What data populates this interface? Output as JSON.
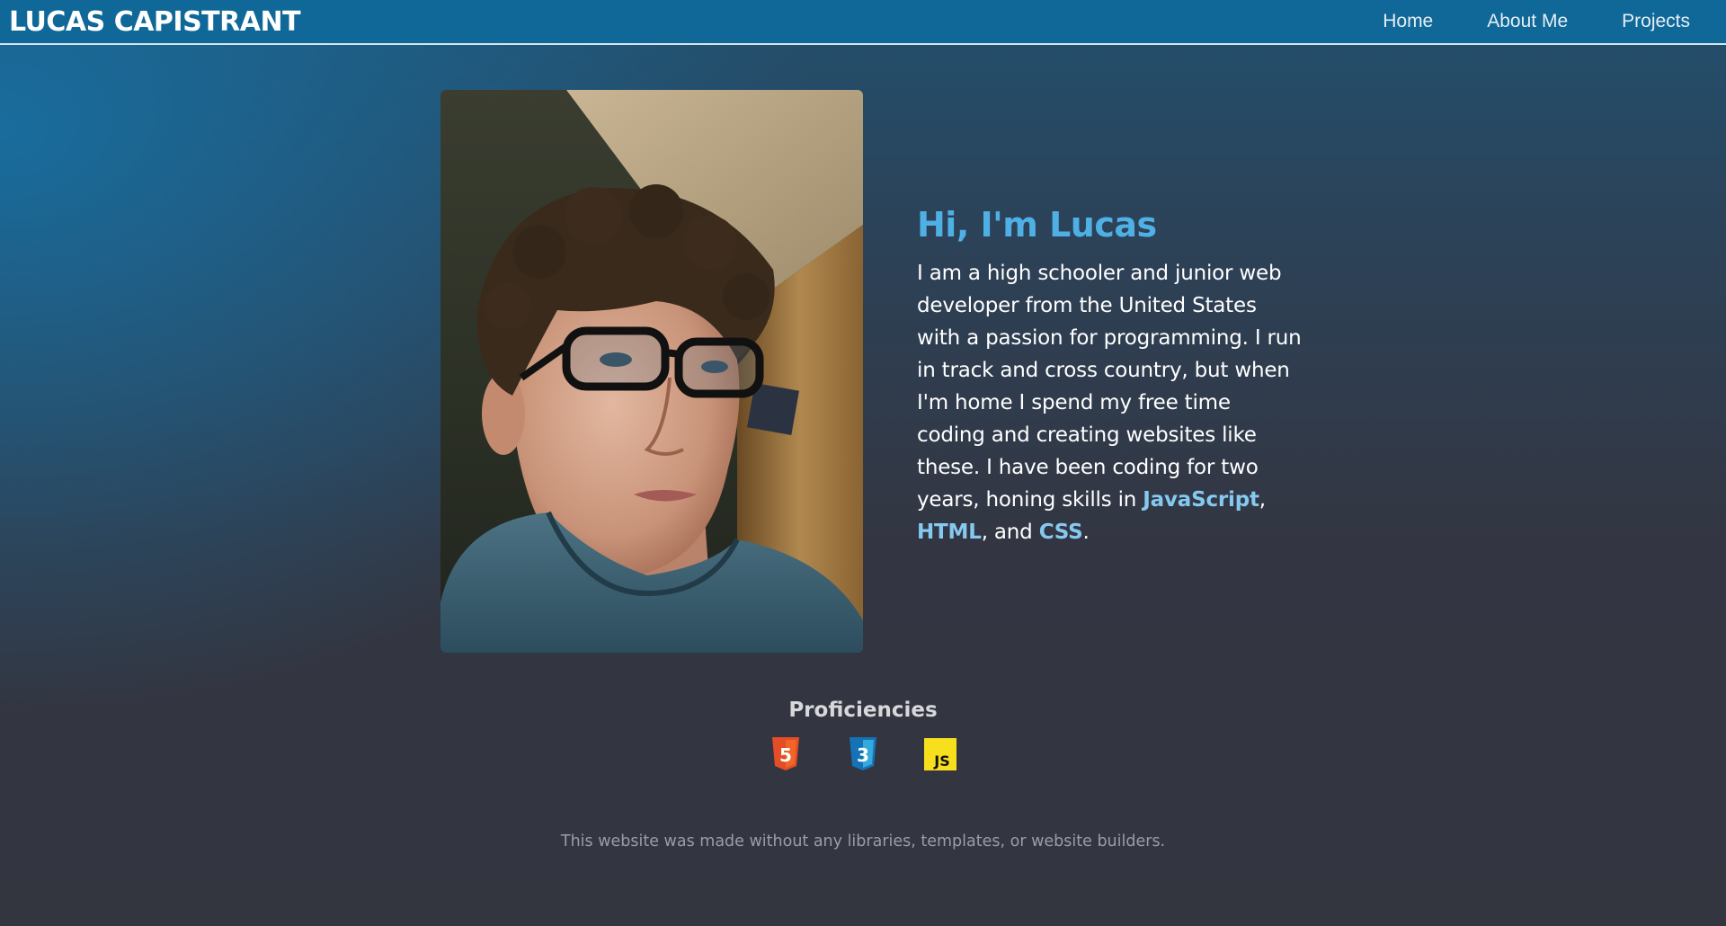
{
  "site": {
    "brand": "LUCAS CAPISTRANT",
    "nav": [
      {
        "label": "Home"
      },
      {
        "label": "About Me"
      },
      {
        "label": "Projects"
      }
    ]
  },
  "hero": {
    "heading": "Hi, I'm Lucas",
    "bio_before": "I am a high schooler and junior web developer from the United States with a passion for programming. I run in track and cross country, but when I'm home I spend my free time coding and creating websites like these. I have been coding for two years, honing skills in ",
    "bio_js": "JavaScript",
    "bio_sep1": ", ",
    "bio_html": "HTML",
    "bio_sep2": ", and ",
    "bio_css": "CSS",
    "bio_end": ".",
    "photo_icon": "portrait-photo"
  },
  "proficiencies": {
    "title": "Proficiencies",
    "items": [
      {
        "icon": "html5-icon",
        "glyph": "5",
        "color": "#e44d26"
      },
      {
        "icon": "css3-icon",
        "glyph": "3",
        "color": "#1572b6"
      },
      {
        "icon": "javascript-icon",
        "glyph": "JS",
        "color": "#f7df1e"
      }
    ]
  },
  "footer": {
    "note": "This website was made without any libraries, templates, or website builders."
  },
  "colors": {
    "navbar": "#0f6898",
    "heading_accent": "#4fb0e6",
    "link_accent": "#86c9f0",
    "background": "#33353f"
  }
}
